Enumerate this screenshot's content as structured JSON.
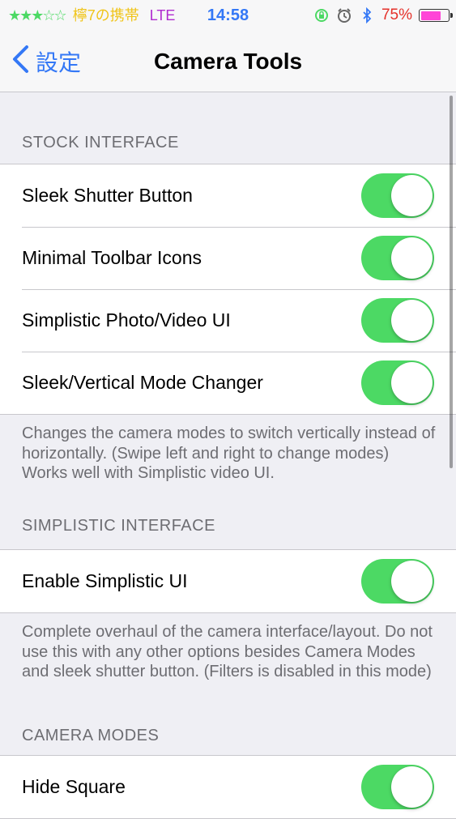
{
  "status_bar": {
    "stars_filled": "★★★",
    "stars_empty": "☆☆",
    "carrier": "檸7の携帯",
    "network": "LTE",
    "time": "14:58",
    "icons": [
      "orientation-lock-icon",
      "alarm-icon",
      "bluetooth-icon"
    ],
    "battery_percent": "75%",
    "battery_level": 0.75,
    "battery_color": "#ff44d7"
  },
  "nav": {
    "back_label": "設定",
    "title": "Camera Tools"
  },
  "sections": {
    "stock": {
      "header": "STOCK INTERFACE",
      "rows": [
        {
          "label": "Sleek Shutter Button",
          "on": true
        },
        {
          "label": "Minimal Toolbar Icons",
          "on": true
        },
        {
          "label": "Simplistic Photo/Video UI",
          "on": true
        },
        {
          "label": "Sleek/Vertical Mode Changer",
          "on": true
        }
      ],
      "footer": "Changes the camera modes to switch vertically instead of horizontally. (Swipe left and right to change modes) Works well with Simplistic video UI."
    },
    "simplistic": {
      "header": "SIMPLISTIC INTERFACE",
      "rows": [
        {
          "label": "Enable Simplistic UI",
          "on": true
        }
      ],
      "footer": "Complete overhaul of the camera interface/layout. Do not use this with any other options besides Camera Modes and sleek shutter button. (Filters is disabled in this mode)"
    },
    "modes": {
      "header": "CAMERA MODES",
      "rows": [
        {
          "label": "Hide Square",
          "on": true
        }
      ]
    }
  },
  "colors": {
    "accent": "#3478f6",
    "toggle_on": "#4cd964",
    "background": "#efeff4"
  }
}
